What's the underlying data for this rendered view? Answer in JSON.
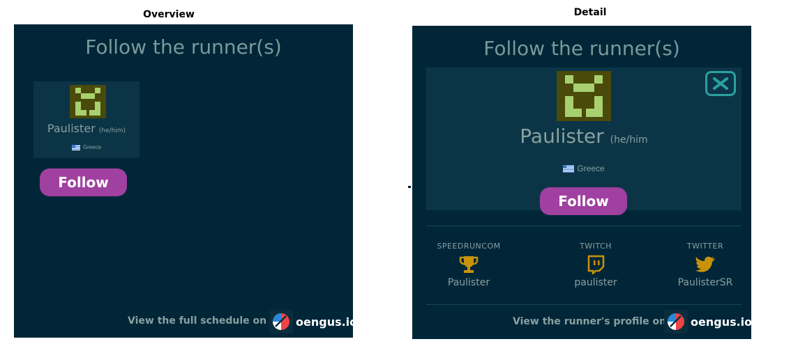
{
  "captions": {
    "overview": "Overview",
    "detail": "Detail"
  },
  "overview": {
    "title": "Follow the runner(s)",
    "runner": {
      "name": "Paulister",
      "pronouns": "(he/him)",
      "country": "Greece"
    },
    "follow_label": "Follow",
    "footer_text": "View the full schedule on",
    "brand": "oengus.io"
  },
  "detail": {
    "title": "Follow the runner(s)",
    "runner": {
      "name": "Paulister",
      "pronouns": "(he/him",
      "country": "Greece"
    },
    "follow_label": "Follow",
    "socials": [
      {
        "label": "SPEEDRUNCOM",
        "value": "Paulister",
        "icon": "trophy-icon"
      },
      {
        "label": "TWITCH",
        "value": "paulister",
        "icon": "twitch-icon"
      },
      {
        "label": "TWITTER",
        "value": "PaulisterSR",
        "icon": "twitter-icon"
      }
    ],
    "footer_text": "View the runner's profile on",
    "brand": "oengus.io"
  },
  "colors": {
    "panel_bg": "#002638",
    "card_bg": "#0b3546",
    "follow_button": "#a040a0",
    "social_icon": "#c8920a",
    "close_button": "#2aa0a0",
    "avatar_dark": "#4a4a0a",
    "avatar_light": "#a8d070"
  }
}
